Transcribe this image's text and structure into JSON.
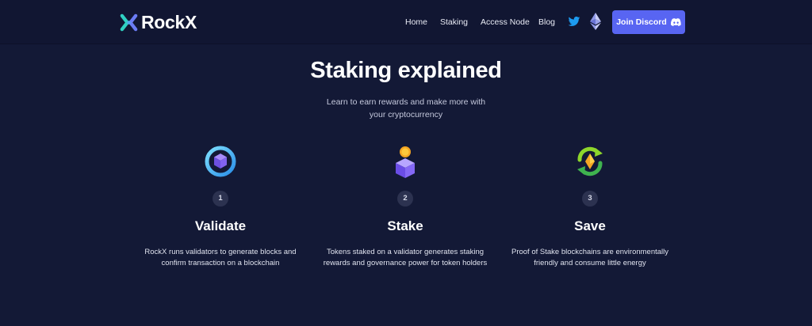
{
  "header": {
    "logo_text": "RockX",
    "nav": [
      "Home",
      "Staking",
      "Access Node",
      "Blog"
    ],
    "social_icons": [
      "twitter-icon",
      "ethereum-icon"
    ],
    "cta_label": "Join Discord",
    "cta_icon": "discord-icon"
  },
  "hero": {
    "title": "Staking explained",
    "subtitle": "Learn to earn rewards and make more with your cryptocurrency"
  },
  "steps": [
    {
      "number": "1",
      "icon": "validator-cube-ring-icon",
      "title": "Validate",
      "description": "RockX runs validators to generate blocks and confirm transaction on a blockchain"
    },
    {
      "number": "2",
      "icon": "stake-coin-cube-icon",
      "title": "Stake",
      "description": "Tokens staked on a validator generates staking rewards and governance power for token holders"
    },
    {
      "number": "3",
      "icon": "eco-recycle-icon",
      "title": "Save",
      "description": "Proof of Stake blockchains are environmentally friendly and consume little energy"
    }
  ],
  "colors": {
    "background": "#131936",
    "navbar": "#111632",
    "discord": "#5865f2",
    "twitter": "#1d9bf0",
    "step_badge": "#2c3250"
  }
}
